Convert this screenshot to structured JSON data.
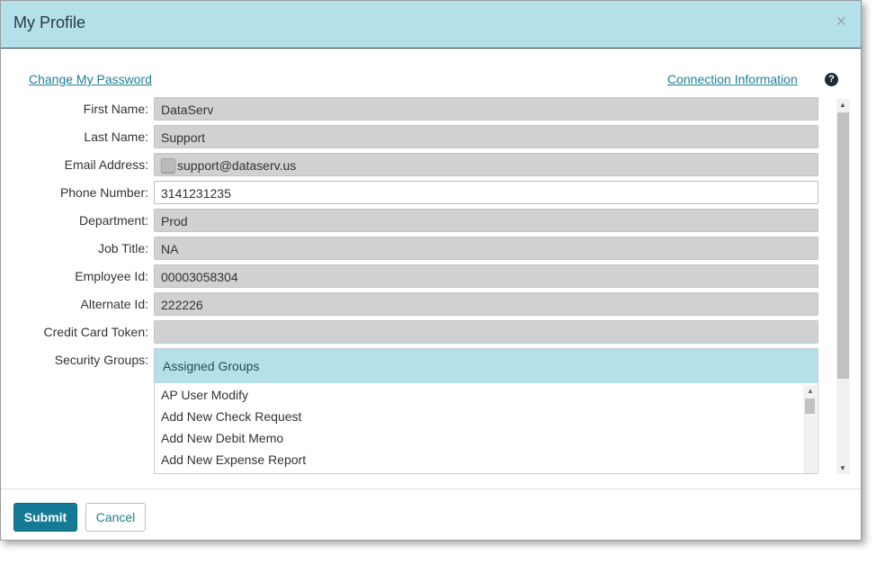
{
  "dialog": {
    "title": "My Profile",
    "close_icon": "×"
  },
  "links": {
    "change_password": "Change My Password",
    "connection_info": "Connection Information",
    "help_icon": "?"
  },
  "fields": [
    {
      "label": "First Name:",
      "value": "DataServ",
      "editable": false
    },
    {
      "label": "Last Name:",
      "value": "Support",
      "editable": false
    },
    {
      "label": "Email Address:",
      "value": "support@dataserv.us",
      "editable": false
    },
    {
      "label": "Phone Number:",
      "value": "3141231235",
      "editable": true
    },
    {
      "label": "Department:",
      "value": "Prod",
      "editable": false
    },
    {
      "label": "Job Title:",
      "value": "NA",
      "editable": false
    },
    {
      "label": "Employee Id:",
      "value": "00003058304",
      "editable": false
    },
    {
      "label": "Alternate Id:",
      "value": "222226",
      "editable": false
    },
    {
      "label": "Credit Card Token:",
      "value": "",
      "editable": false
    }
  ],
  "security_groups": {
    "label": "Security Groups:",
    "header": "Assigned Groups",
    "items": [
      "AP User Modify",
      "Add New Check Request",
      "Add New Debit Memo",
      "Add New Expense Report"
    ]
  },
  "footer": {
    "submit_label": "Submit",
    "cancel_label": "Cancel"
  },
  "colors": {
    "header_bg": "#b4e0ea",
    "accent": "#147a96",
    "link": "#1e7e98"
  }
}
